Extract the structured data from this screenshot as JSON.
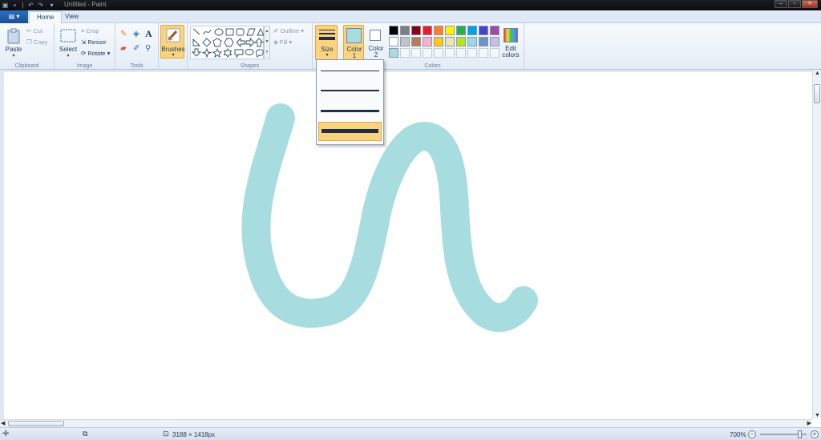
{
  "window": {
    "title": "Untitled - Paint"
  },
  "tabs": {
    "file": "",
    "home": "Home",
    "view": "View"
  },
  "clipboard": {
    "paste": "Paste",
    "cut": "Cut",
    "copy": "Copy",
    "group": "Clipboard"
  },
  "image": {
    "select": "Select",
    "crop": "Crop",
    "resize": "Resize",
    "rotate": "Rotate",
    "group": "Image"
  },
  "tools": {
    "group": "Tools"
  },
  "brushes": {
    "label": "Brushes"
  },
  "shapes": {
    "outline": "Outline",
    "fill": "Fill",
    "group": "Shapes"
  },
  "size": {
    "label": "Size"
  },
  "colors": {
    "color1": "Color\n1",
    "color1_a": "Color",
    "color1_b": "1",
    "color2_a": "Color",
    "color2_b": "2",
    "edit_a": "Edit",
    "edit_b": "colors",
    "group": "Colors",
    "color1_value": "#a8dde0",
    "color2_value": "#ffffff",
    "palette_row1": [
      "#000000",
      "#7f7f7f",
      "#880015",
      "#ed1c24",
      "#ff7f27",
      "#fff200",
      "#22b14c",
      "#00a2e8",
      "#3f48cc",
      "#a349a4"
    ],
    "palette_row2": [
      "#ffffff",
      "#c3c3c3",
      "#b97a57",
      "#ffaec9",
      "#ffc90e",
      "#efe4b0",
      "#b5e61d",
      "#99d9ea",
      "#7092be",
      "#c8bfe7"
    ],
    "palette_row3": [
      "#a8dde0",
      "",
      "",
      "",
      "",
      "",
      "",
      "",
      "",
      ""
    ]
  },
  "canvas": {
    "stroke_color": "#a8dde0"
  },
  "status": {
    "dimensions": "3188 × 1418px",
    "zoom": "700%",
    "zoom_fraction": 0.84
  }
}
